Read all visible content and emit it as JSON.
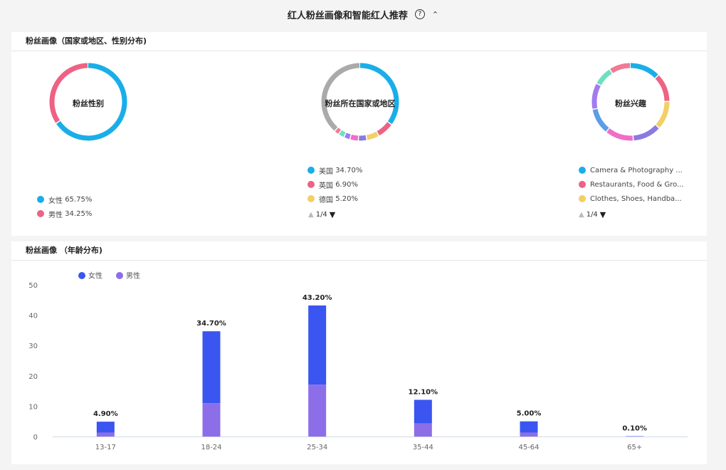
{
  "header": {
    "title": "红人粉丝画像和智能红人推荐",
    "help_icon": "?",
    "collapse_icon": "^"
  },
  "geo_gender_panel": {
    "title": "粉丝画像（国家或地区、性别分布)",
    "gender": {
      "label": "粉丝性别",
      "items": [
        {
          "name": "女性",
          "value": "65.75%",
          "pct": 65.75,
          "color": "#1aaee8"
        },
        {
          "name": "男性",
          "value": "34.25%",
          "pct": 34.25,
          "color": "#ee6283"
        }
      ]
    },
    "country": {
      "label": "粉丝所在国家或地区",
      "legend": [
        {
          "name": "美国",
          "value": "34.70%",
          "color": "#1aaee8"
        },
        {
          "name": "英国",
          "value": "6.90%",
          "color": "#ee6283"
        },
        {
          "name": "德国",
          "value": "5.20%",
          "color": "#f2cf67"
        }
      ],
      "pager": "1/4"
    },
    "interest": {
      "label": "粉丝兴趣",
      "legend": [
        {
          "name": "Camera & Photography ...",
          "color": "#1aaee8"
        },
        {
          "name": "Restaurants, Food & Gro...",
          "color": "#ee6283"
        },
        {
          "name": "Clothes, Shoes, Handba...",
          "color": "#f2cf67"
        }
      ],
      "pager": "1/4"
    }
  },
  "age_panel": {
    "title": "粉丝画像 （年龄分布)"
  },
  "chart_data": {
    "type": "bar",
    "stacked": true,
    "categories": [
      "13-17",
      "18-24",
      "25-34",
      "35-44",
      "45-64",
      "65+"
    ],
    "series": [
      {
        "name": "女性",
        "values": [
          3.6,
          23.7,
          26.1,
          7.8,
          3.7,
          0.1
        ],
        "color": "#3a55f0"
      },
      {
        "name": "男性",
        "values": [
          1.3,
          11.0,
          17.1,
          4.3,
          1.3,
          0.0
        ],
        "color": "#8c6ee8"
      }
    ],
    "totals": [
      "4.90%",
      "34.70%",
      "43.20%",
      "12.10%",
      "5.00%",
      "0.10%"
    ],
    "yticks": [
      0,
      10,
      20,
      30,
      40,
      50
    ],
    "ylim": [
      0,
      50
    ],
    "legend_position": "top-left"
  }
}
